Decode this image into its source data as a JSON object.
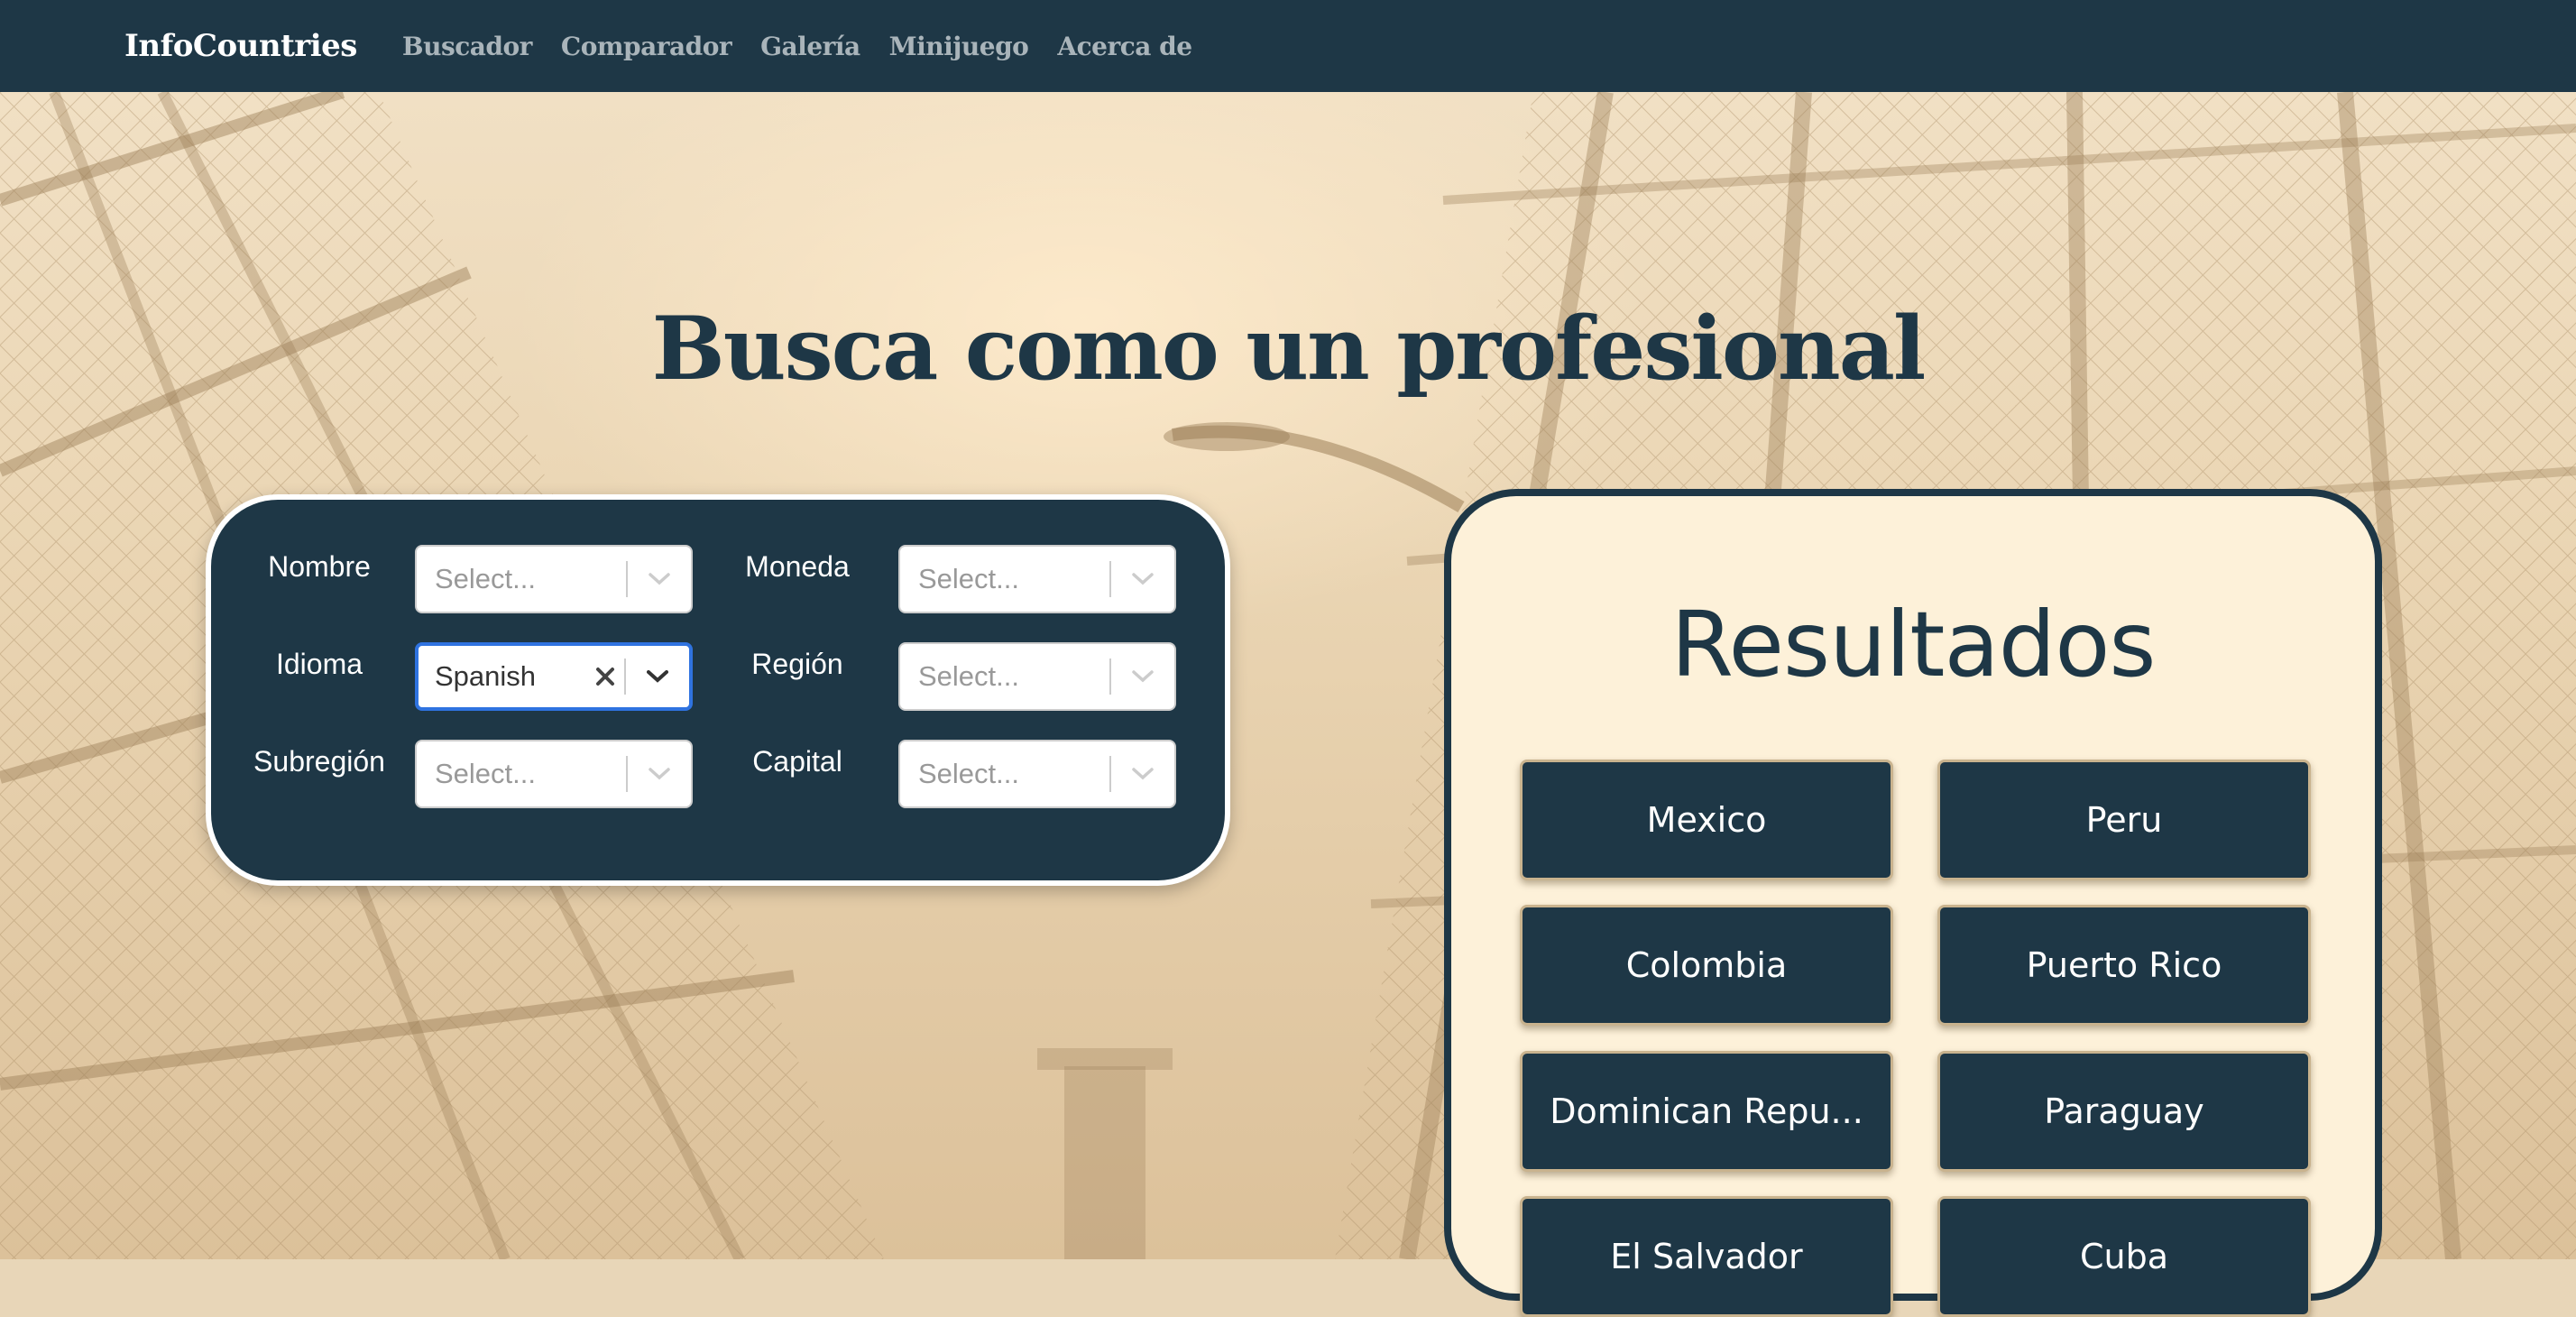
{
  "navbar": {
    "brand": "InfoCountries",
    "links": [
      "Buscador",
      "Comparador",
      "Galería",
      "Minijuego",
      "Acerca de"
    ]
  },
  "hero": {
    "title": "Busca como un profesional"
  },
  "filters": {
    "nombre": {
      "label": "Nombre",
      "value": "Select..."
    },
    "moneda": {
      "label": "Moneda",
      "value": "Select..."
    },
    "idioma": {
      "label": "Idioma",
      "value": "Spanish"
    },
    "region": {
      "label": "Región",
      "value": "Select..."
    },
    "subregion": {
      "label": "Subregión",
      "value": "Select..."
    },
    "capital": {
      "label": "Capital",
      "value": "Select..."
    }
  },
  "results": {
    "title": "Resultados",
    "items": [
      "Mexico",
      "Peru",
      "Colombia",
      "Puerto Rico",
      "Dominican Repu...",
      "Paraguay",
      "El Salvador",
      "Cuba"
    ]
  },
  "colors": {
    "primary": "#1e3746",
    "accent_focus": "#2f73e0",
    "panel_bg": "#fdf1d9"
  },
  "icons": {
    "clear": "close-icon",
    "dropdown": "chevron-down-icon"
  }
}
